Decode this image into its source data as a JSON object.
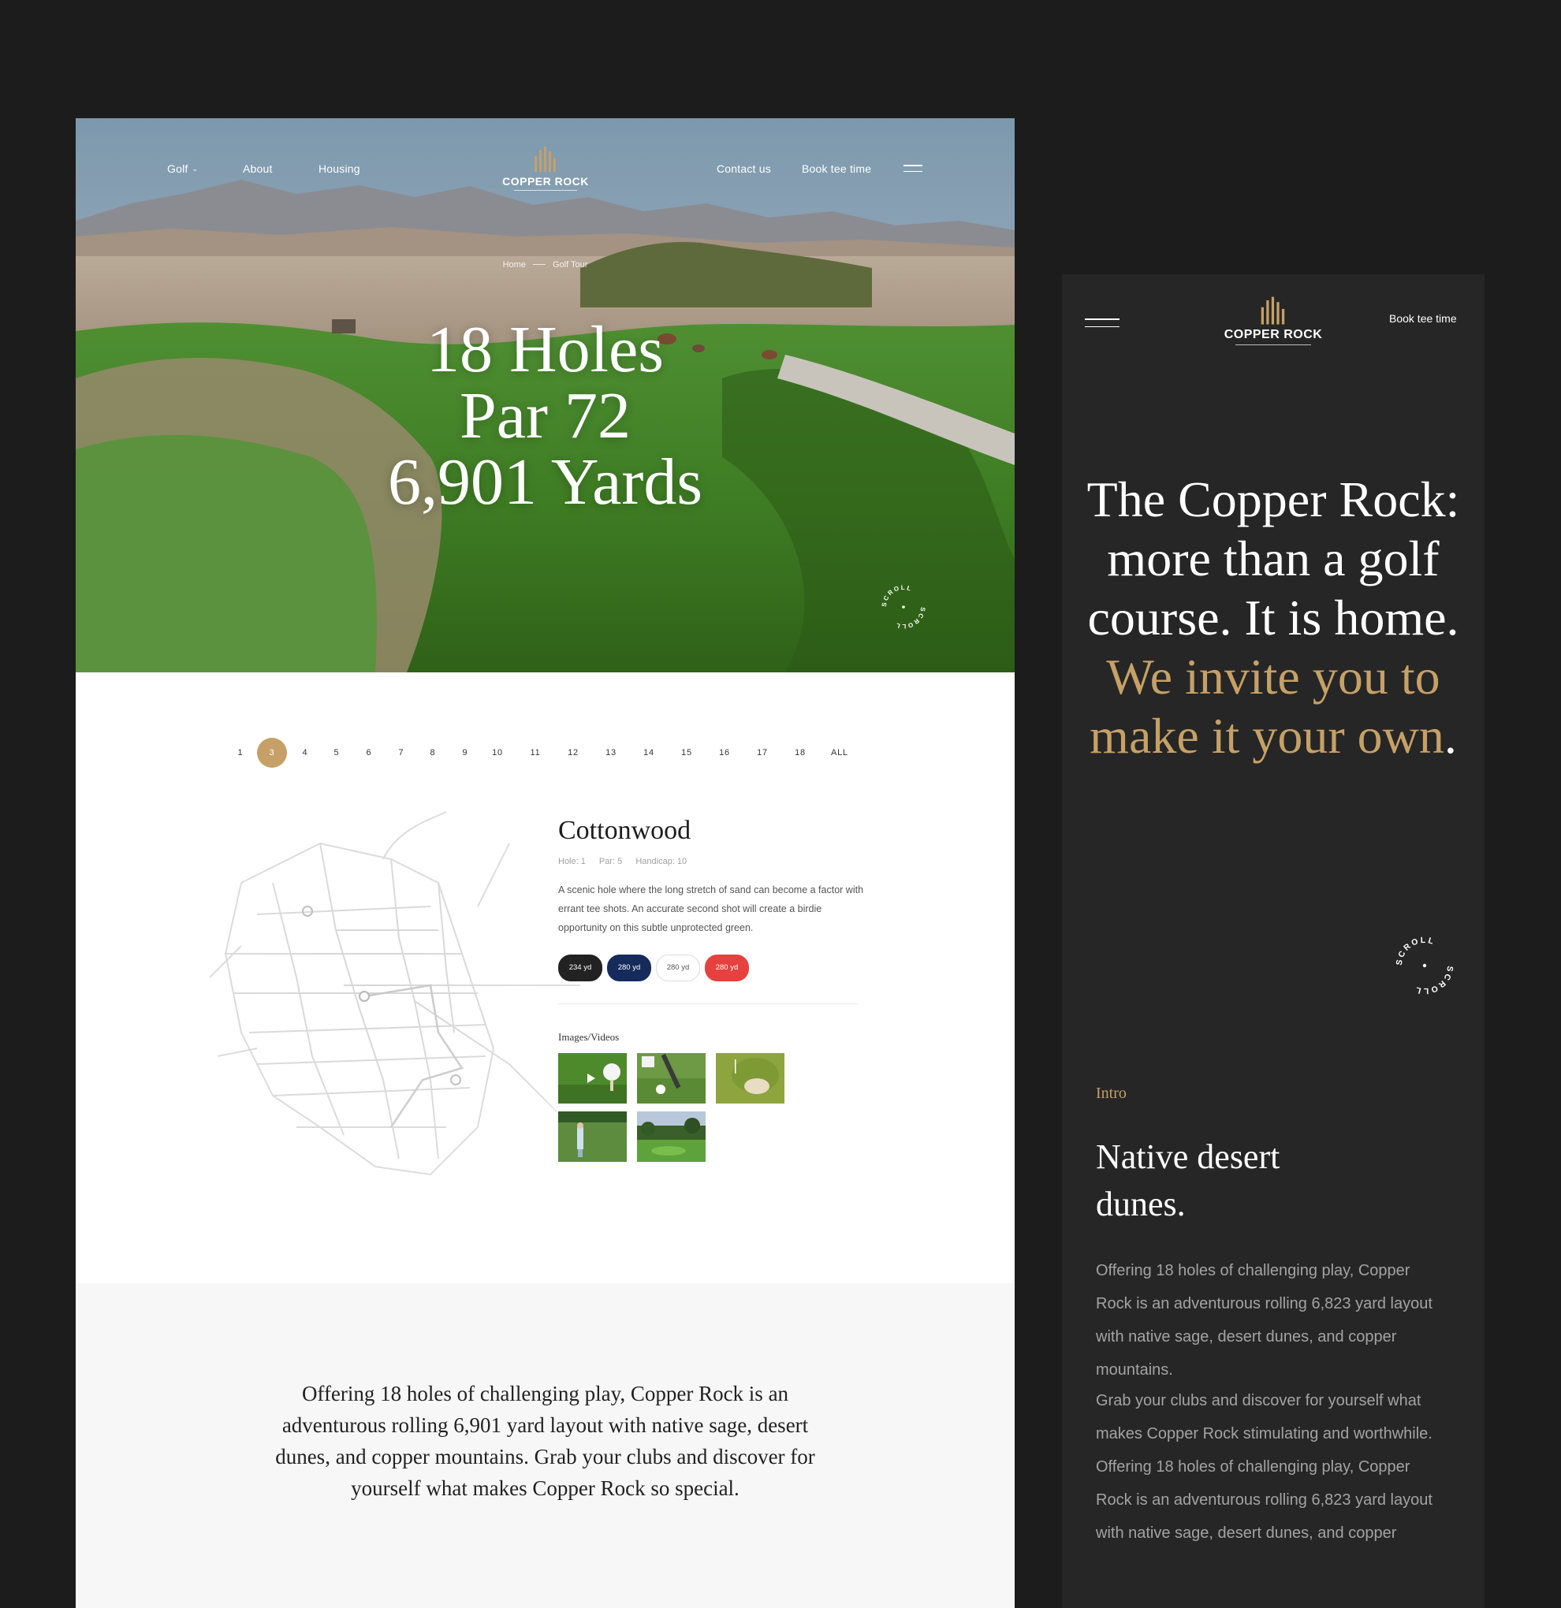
{
  "brand": {
    "name": "COPPER ROCK",
    "gold": "#c6a066",
    "dark": "#262626"
  },
  "desktop": {
    "nav": {
      "left": [
        "Golf",
        "About",
        "Housing"
      ],
      "right": [
        "Contact us",
        "Book tee time"
      ],
      "menu_icon": "hamburger-icon"
    },
    "breadcrumb": [
      "Home",
      "Golf Tour"
    ],
    "hero": {
      "lines": [
        "18 Holes",
        "Par 72",
        "6,901 Yards"
      ]
    },
    "scroll_label": "SCROLL",
    "hole_tabs": [
      "1",
      "3",
      "4",
      "5",
      "6",
      "7",
      "8",
      "9",
      "10",
      "11",
      "12",
      "13",
      "14",
      "15",
      "16",
      "17",
      "18",
      "ALL"
    ],
    "active_tab": "3",
    "hole": {
      "name": "Cottonwood",
      "meta": [
        "Hole: 1",
        "Par: 5",
        "Handicap: 10"
      ],
      "description": "A scenic hole where the long stretch of sand can become a factor with errant tee shots. An accurate second shot will create a birdie opportunity on this subtle unprotected green.",
      "tees": [
        {
          "label": "234 yd",
          "bg": "#222222",
          "fg": "#ffffff",
          "border": "#222222"
        },
        {
          "label": "280 yd",
          "bg": "#152b5c",
          "fg": "#ffffff",
          "border": "#152b5c"
        },
        {
          "label": "280 yd",
          "bg": "#ffffff",
          "fg": "#555555",
          "border": "#dddddd"
        },
        {
          "label": "280 yd",
          "bg": "#e6403f",
          "fg": "#ffffff",
          "border": "#e6403f"
        }
      ],
      "media_label": "Images/Videos"
    },
    "description": "Offering 18 holes of challenging play, Copper Rock is an adventurous rolling 6,901 yard layout with native sage, desert dunes, and copper mountains. Grab your clubs and discover for yourself what makes Copper Rock so special."
  },
  "mobile": {
    "book_label": "Book tee time",
    "headline_white": "The Copper Rock: more than a golf course. It is home. ",
    "headline_gold": "We invite you to make it your own",
    "headline_end": ".",
    "scroll_label": "SCROLL",
    "intro_label": "Intro",
    "section_title": "Native desert dunes.",
    "paragraph1": "Offering 18 holes of challenging play, Copper Rock is an adventurous rolling 6,823 yard layout with native sage, desert dunes, and copper mountains.",
    "paragraph2": "Grab your clubs and discover for yourself what makes Copper Rock stimulating and worthwhile. Offering 18 holes of challenging play, Copper Rock is an adventurous rolling 6,823 yard layout with native sage, desert dunes, and copper"
  }
}
